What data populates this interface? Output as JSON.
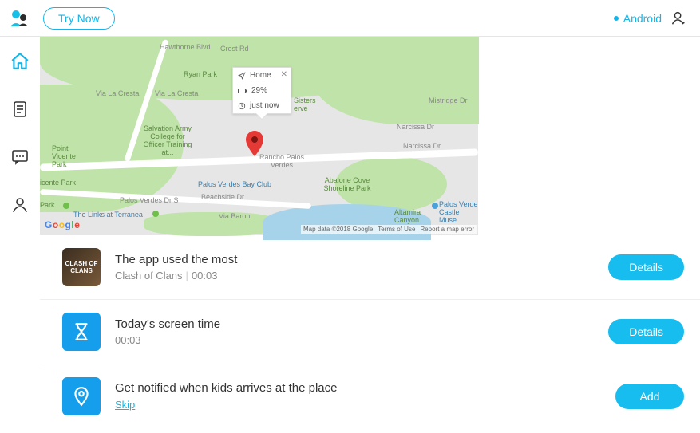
{
  "header": {
    "try_label": "Try Now",
    "platform": "Android"
  },
  "map": {
    "callout": {
      "title": "Home",
      "battery": "29%",
      "time": "just now"
    },
    "labels": {
      "hawthorne": "Hawthorne Blvd",
      "crest": "Crest Rd",
      "ryan_park": "Ryan Park",
      "vialacresta": "Via La Cresta",
      "salvation": "Salvation Army College for Officer Training at...",
      "point_vicente": "Point Vicente Park",
      "icente_park": "icente Park",
      "park": "Park",
      "links": "The Links at Terranea",
      "pv_bay_club": "Palos Verdes Bay Club",
      "rancho": "Rancho Palos Verdes",
      "pv_dr_s": "Palos Verdes Dr S",
      "beachside": "Beachside Dr",
      "via_baron": "Via Baron",
      "abalone": "Abalone Cove Shoreline Park",
      "altamira": "Altamira Canyon",
      "castle": "Palos Verde Castle Muse",
      "sisters": "Sisters erve",
      "narcissa": "Narcissa Dr",
      "narcissa2": "Narcissa Dr",
      "mistridge": "Mistridge Dr"
    },
    "google": [
      "G",
      "o",
      "o",
      "g",
      "l",
      "e"
    ],
    "footer": {
      "copyright": "Map data ©2018 Google",
      "terms": "Terms of Use",
      "report": "Report a map error"
    }
  },
  "cards": [
    {
      "thumb_text": "CLASH OF CLANS",
      "title": "The app used the most",
      "sub_name": "Clash of Clans",
      "sub_time": "00:03",
      "action": "Details"
    },
    {
      "title": "Today's screen time",
      "sub_time": "00:03",
      "action": "Details"
    },
    {
      "title": "Get notified when kids arrives at the place",
      "skip": "Skip",
      "action": "Add"
    }
  ]
}
